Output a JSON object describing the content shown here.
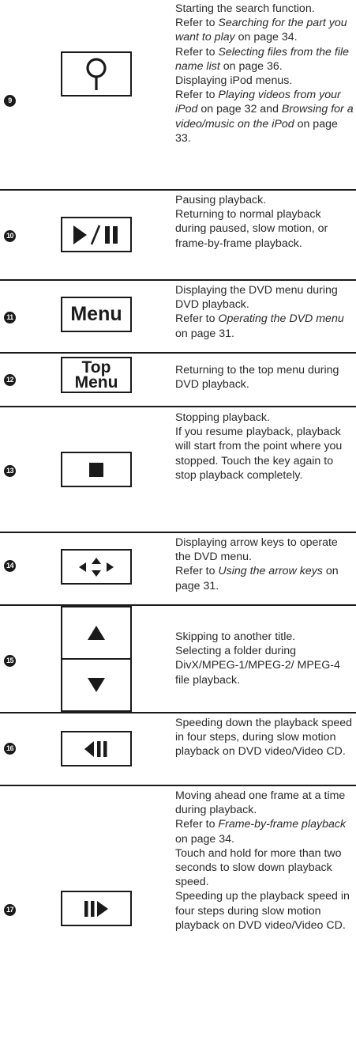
{
  "rows": [
    {
      "number": "9",
      "icon": "search-key-icon",
      "lines": [
        [
          "Starting the search function."
        ],
        [
          "Refer to ",
          {
            "i": "Searching for the part you want to play"
          },
          " on page 34."
        ],
        [
          "Refer to ",
          {
            "i": "Selecting files from the file name list"
          },
          " on page 36."
        ],
        [
          "Displaying iPod menus."
        ],
        [
          "Refer to ",
          {
            "i": "Playing videos from your iPod"
          },
          " on page 32 and ",
          {
            "i": "Browsing for a video/music on the iPod"
          },
          " on page 33."
        ]
      ]
    },
    {
      "number": "10",
      "icon": "play-pause-icon",
      "lines": [
        [
          "Pausing playback."
        ],
        [
          "Returning to normal play­back during paused, slow motion, or frame-by-frame playback."
        ]
      ]
    },
    {
      "number": "11",
      "icon": "menu-key",
      "key_label": "Menu",
      "lines": [
        [
          "Displaying the DVD menu during DVD playback."
        ],
        [
          "Refer to ",
          {
            "i": "Operating the DVD menu"
          },
          " on page 31."
        ]
      ]
    },
    {
      "number": "12",
      "icon": "top-menu-key",
      "key_label_1": "Top",
      "key_label_2": "Menu",
      "lines": [
        [
          "Returning to the top menu during DVD playback."
        ]
      ]
    },
    {
      "number": "13",
      "icon": "stop-icon",
      "lines": [
        [
          "Stopping playback."
        ],
        [
          "If you resume playback, play­back will start from the point where you stopped. Touch the key again to stop play­back completely."
        ]
      ]
    },
    {
      "number": "14",
      "icon": "arrow-keys-icon",
      "lines": [
        [
          "Displaying arrow keys to op­erate the DVD menu."
        ],
        [
          "Refer to ",
          {
            "i": "Using the arrow keys"
          },
          " on page 31."
        ]
      ]
    },
    {
      "number": "15",
      "icon": "up-down-icon",
      "lines": [
        [
          "Skipping to another title."
        ],
        [
          "Selecting a folder during DivX/MPEG-1/MPEG-2/ MPEG-4 file playback."
        ]
      ]
    },
    {
      "number": "16",
      "icon": "slow-reverse-icon",
      "lines": [
        [
          "Speeding down the playback speed in four steps, during slow motion playback on DVD video/Video CD."
        ]
      ]
    },
    {
      "number": "17",
      "icon": "frame-advance-icon",
      "lines": [
        [
          "Moving ahead one frame at a time during playback."
        ],
        [
          "Refer to ",
          {
            "i": "Frame-by-frame play­back"
          },
          " on page 34."
        ],
        [
          "Touch and hold for more than two seconds to slow down playback speed."
        ],
        [
          "Speeding up the playback speed in four steps during slow motion playback on DVD video/Video CD."
        ]
      ]
    }
  ]
}
